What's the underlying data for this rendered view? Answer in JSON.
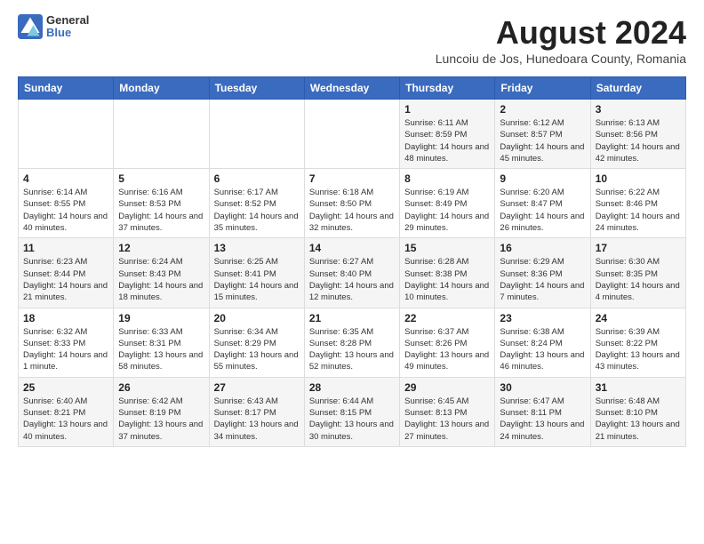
{
  "logo": {
    "general": "General",
    "blue": "Blue"
  },
  "title": "August 2024",
  "subtitle": "Luncoiu de Jos, Hunedoara County, Romania",
  "headers": [
    "Sunday",
    "Monday",
    "Tuesday",
    "Wednesday",
    "Thursday",
    "Friday",
    "Saturday"
  ],
  "weeks": [
    [
      {
        "day": "",
        "info": ""
      },
      {
        "day": "",
        "info": ""
      },
      {
        "day": "",
        "info": ""
      },
      {
        "day": "",
        "info": ""
      },
      {
        "day": "1",
        "info": "Sunrise: 6:11 AM\nSunset: 8:59 PM\nDaylight: 14 hours and 48 minutes."
      },
      {
        "day": "2",
        "info": "Sunrise: 6:12 AM\nSunset: 8:57 PM\nDaylight: 14 hours and 45 minutes."
      },
      {
        "day": "3",
        "info": "Sunrise: 6:13 AM\nSunset: 8:56 PM\nDaylight: 14 hours and 42 minutes."
      }
    ],
    [
      {
        "day": "4",
        "info": "Sunrise: 6:14 AM\nSunset: 8:55 PM\nDaylight: 14 hours and 40 minutes."
      },
      {
        "day": "5",
        "info": "Sunrise: 6:16 AM\nSunset: 8:53 PM\nDaylight: 14 hours and 37 minutes."
      },
      {
        "day": "6",
        "info": "Sunrise: 6:17 AM\nSunset: 8:52 PM\nDaylight: 14 hours and 35 minutes."
      },
      {
        "day": "7",
        "info": "Sunrise: 6:18 AM\nSunset: 8:50 PM\nDaylight: 14 hours and 32 minutes."
      },
      {
        "day": "8",
        "info": "Sunrise: 6:19 AM\nSunset: 8:49 PM\nDaylight: 14 hours and 29 minutes."
      },
      {
        "day": "9",
        "info": "Sunrise: 6:20 AM\nSunset: 8:47 PM\nDaylight: 14 hours and 26 minutes."
      },
      {
        "day": "10",
        "info": "Sunrise: 6:22 AM\nSunset: 8:46 PM\nDaylight: 14 hours and 24 minutes."
      }
    ],
    [
      {
        "day": "11",
        "info": "Sunrise: 6:23 AM\nSunset: 8:44 PM\nDaylight: 14 hours and 21 minutes."
      },
      {
        "day": "12",
        "info": "Sunrise: 6:24 AM\nSunset: 8:43 PM\nDaylight: 14 hours and 18 minutes."
      },
      {
        "day": "13",
        "info": "Sunrise: 6:25 AM\nSunset: 8:41 PM\nDaylight: 14 hours and 15 minutes."
      },
      {
        "day": "14",
        "info": "Sunrise: 6:27 AM\nSunset: 8:40 PM\nDaylight: 14 hours and 12 minutes."
      },
      {
        "day": "15",
        "info": "Sunrise: 6:28 AM\nSunset: 8:38 PM\nDaylight: 14 hours and 10 minutes."
      },
      {
        "day": "16",
        "info": "Sunrise: 6:29 AM\nSunset: 8:36 PM\nDaylight: 14 hours and 7 minutes."
      },
      {
        "day": "17",
        "info": "Sunrise: 6:30 AM\nSunset: 8:35 PM\nDaylight: 14 hours and 4 minutes."
      }
    ],
    [
      {
        "day": "18",
        "info": "Sunrise: 6:32 AM\nSunset: 8:33 PM\nDaylight: 14 hours and 1 minute."
      },
      {
        "day": "19",
        "info": "Sunrise: 6:33 AM\nSunset: 8:31 PM\nDaylight: 13 hours and 58 minutes."
      },
      {
        "day": "20",
        "info": "Sunrise: 6:34 AM\nSunset: 8:29 PM\nDaylight: 13 hours and 55 minutes."
      },
      {
        "day": "21",
        "info": "Sunrise: 6:35 AM\nSunset: 8:28 PM\nDaylight: 13 hours and 52 minutes."
      },
      {
        "day": "22",
        "info": "Sunrise: 6:37 AM\nSunset: 8:26 PM\nDaylight: 13 hours and 49 minutes."
      },
      {
        "day": "23",
        "info": "Sunrise: 6:38 AM\nSunset: 8:24 PM\nDaylight: 13 hours and 46 minutes."
      },
      {
        "day": "24",
        "info": "Sunrise: 6:39 AM\nSunset: 8:22 PM\nDaylight: 13 hours and 43 minutes."
      }
    ],
    [
      {
        "day": "25",
        "info": "Sunrise: 6:40 AM\nSunset: 8:21 PM\nDaylight: 13 hours and 40 minutes."
      },
      {
        "day": "26",
        "info": "Sunrise: 6:42 AM\nSunset: 8:19 PM\nDaylight: 13 hours and 37 minutes."
      },
      {
        "day": "27",
        "info": "Sunrise: 6:43 AM\nSunset: 8:17 PM\nDaylight: 13 hours and 34 minutes."
      },
      {
        "day": "28",
        "info": "Sunrise: 6:44 AM\nSunset: 8:15 PM\nDaylight: 13 hours and 30 minutes."
      },
      {
        "day": "29",
        "info": "Sunrise: 6:45 AM\nSunset: 8:13 PM\nDaylight: 13 hours and 27 minutes."
      },
      {
        "day": "30",
        "info": "Sunrise: 6:47 AM\nSunset: 8:11 PM\nDaylight: 13 hours and 24 minutes."
      },
      {
        "day": "31",
        "info": "Sunrise: 6:48 AM\nSunset: 8:10 PM\nDaylight: 13 hours and 21 minutes."
      }
    ]
  ]
}
